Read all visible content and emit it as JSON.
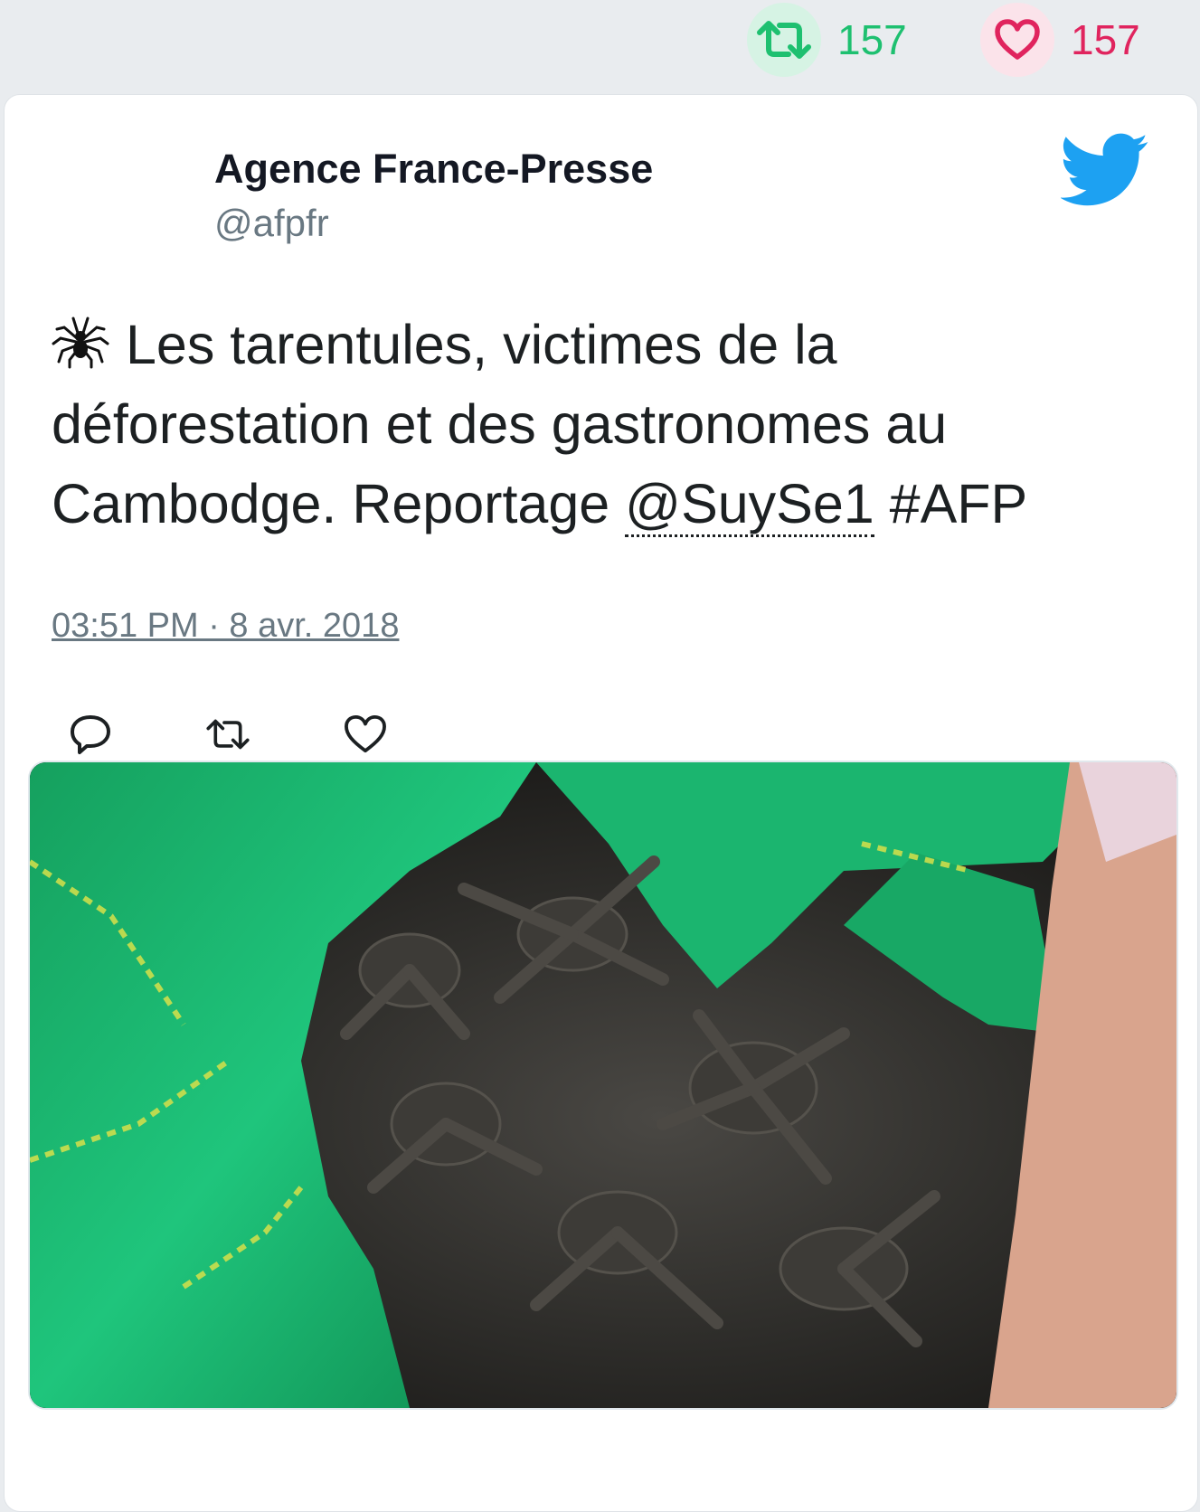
{
  "stats": {
    "retweets": "157",
    "likes": "157",
    "retweet_color": "#1ec070",
    "like_color": "#e0245e"
  },
  "tweet": {
    "author_name": "Agence France-Presse",
    "author_handle": "@afpfr",
    "emoji_icon": "spider-icon",
    "text_before": "Les tarentules, victimes de la déforestation et des gastronomes au Cambodge. Reportage ",
    "mention": "@SuySe1",
    "text_after": " #AFP",
    "timestamp": "03:51 PM · 8 avr. 2018"
  },
  "actions": [
    "reply-icon",
    "retweet-icon",
    "like-icon"
  ],
  "media": {
    "icon": "video-thumbnail-tarantulas"
  },
  "colors": {
    "twitter_blue": "#1da1f2",
    "page_bg": "#e9ecef"
  }
}
